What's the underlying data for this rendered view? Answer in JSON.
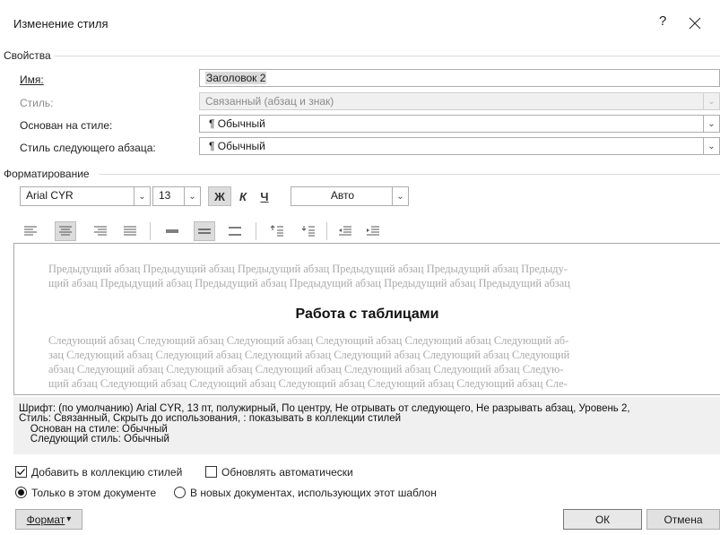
{
  "dialog": {
    "title": "Изменение стиля",
    "help_icon": "?",
    "close_icon": "✕"
  },
  "properties": {
    "section_label": "Свойства",
    "name": {
      "label": "Имя:",
      "value": "Заголовок 2"
    },
    "style_type": {
      "label": "Стиль:",
      "value": "Связанный (абзац и знак)",
      "disabled": true
    },
    "based_on": {
      "label": "Основан на стиле:",
      "value": "¶ Обычный"
    },
    "next_style": {
      "label": "Стиль следующего абзаца:",
      "value": "¶ Обычный"
    }
  },
  "formatting": {
    "section_label": "Форматирование",
    "font_name": "Arial CYR",
    "font_size": "13",
    "bold_label": "Ж",
    "italic_label": "К",
    "underline_label": "Ч",
    "color_value": "Авто",
    "align_icons": [
      "align-left-icon",
      "align-center-icon",
      "align-right-icon",
      "justify-icon"
    ],
    "spacing_icons": [
      "single-spacing-icon",
      "one-half-spacing-icon",
      "double-spacing-icon"
    ],
    "para_spacing_icons": [
      "space-before-icon",
      "space-after-icon"
    ],
    "indent_icons": [
      "decrease-indent-icon",
      "increase-indent-icon"
    ]
  },
  "preview": {
    "prev_lines": [
      "Предыдущий абзац Предыдущий абзац Предыдущий абзац Предыдущий абзац Предыдущий абзац Предыду-",
      "щий абзац Предыдущий абзац Предыдущий абзац Предыдущий абзац Предыдущий абзац Предыдущий абзац"
    ],
    "sample_text": "Работа с таблицами",
    "next_lines": [
      "Следующий абзац Следующий абзац Следующий абзац Следующий абзац Следующий абзац Следующий аб-",
      "зац Следующий абзац Следующий абзац Следующий абзац Следующий абзац Следующий абзац Следующий",
      "абзац Следующий абзац Следующий абзац Следующий абзац Следующий абзац Следующий абзац Следую-",
      "щий абзац Следующий абзац Следующий абзац Следующий абзац Следующий абзац Следующий абзац Сле-"
    ]
  },
  "description": {
    "lines": [
      "Шрифт: (по умолчанию) Arial CYR, 13 пт, полужирный, По центру, Не отрывать от следующего, Не разрывать абзац, Уровень 2,",
      "Стиль: Связанный, Скрыть до использования, : показывать в коллекции стилей",
      "    Основан на стиле: Обычный",
      "    Следующий стиль: Обычный"
    ]
  },
  "options": {
    "add_to_gallery": {
      "label": "Добавить в коллекцию стилей",
      "checked": true
    },
    "auto_update": {
      "label": "Обновлять автоматически",
      "checked": false
    },
    "only_this_doc": {
      "label": "Только в этом документе",
      "selected": true
    },
    "new_docs": {
      "label": "В новых документах, использующих этот шаблон",
      "selected": false
    }
  },
  "buttons": {
    "format": "Формат",
    "format_arrow": "▾",
    "ok": "ОК",
    "cancel": "Отмена"
  },
  "colors": {
    "ghost_text": "#a9a9a9",
    "pressed_button": "#dcdcdc",
    "description_bg": "#f0f0f0"
  }
}
